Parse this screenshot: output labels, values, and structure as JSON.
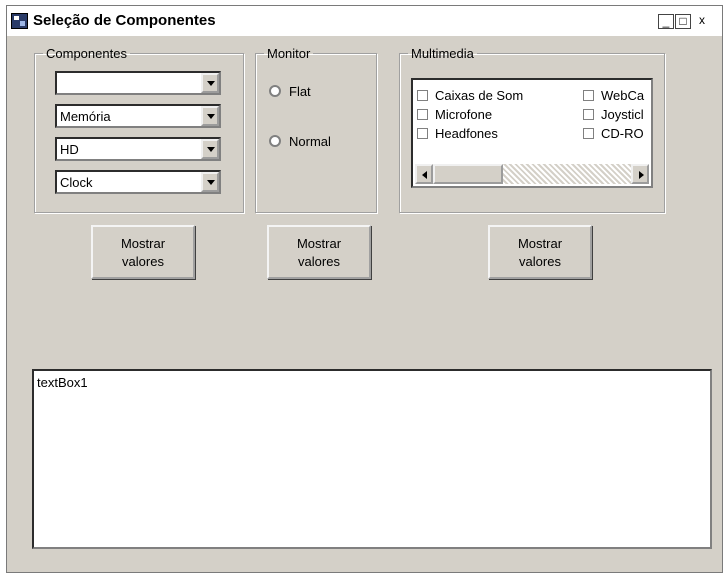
{
  "window": {
    "title": "Seleção de Componentes",
    "controls": {
      "minimize": "_",
      "maximize": "□",
      "close": "x"
    }
  },
  "componentes": {
    "legend": "Componentes",
    "combos": [
      "",
      "Memória",
      "HD",
      "Clock"
    ]
  },
  "monitor": {
    "legend": "Monitor",
    "options": [
      "Flat",
      "Normal"
    ]
  },
  "multimedia": {
    "legend": "Multimedia",
    "items_col1": [
      "Caixas de Som",
      "Microfone",
      "Headfones"
    ],
    "items_col2": [
      "WebCa",
      "Joysticl",
      "CD-RO"
    ]
  },
  "buttons": {
    "componentes": "Mostrar\nvalores",
    "monitor": "Mostrar\nvalores",
    "multimedia": "Mostrar\nvalores"
  },
  "textbox": {
    "value": "textBox1"
  }
}
